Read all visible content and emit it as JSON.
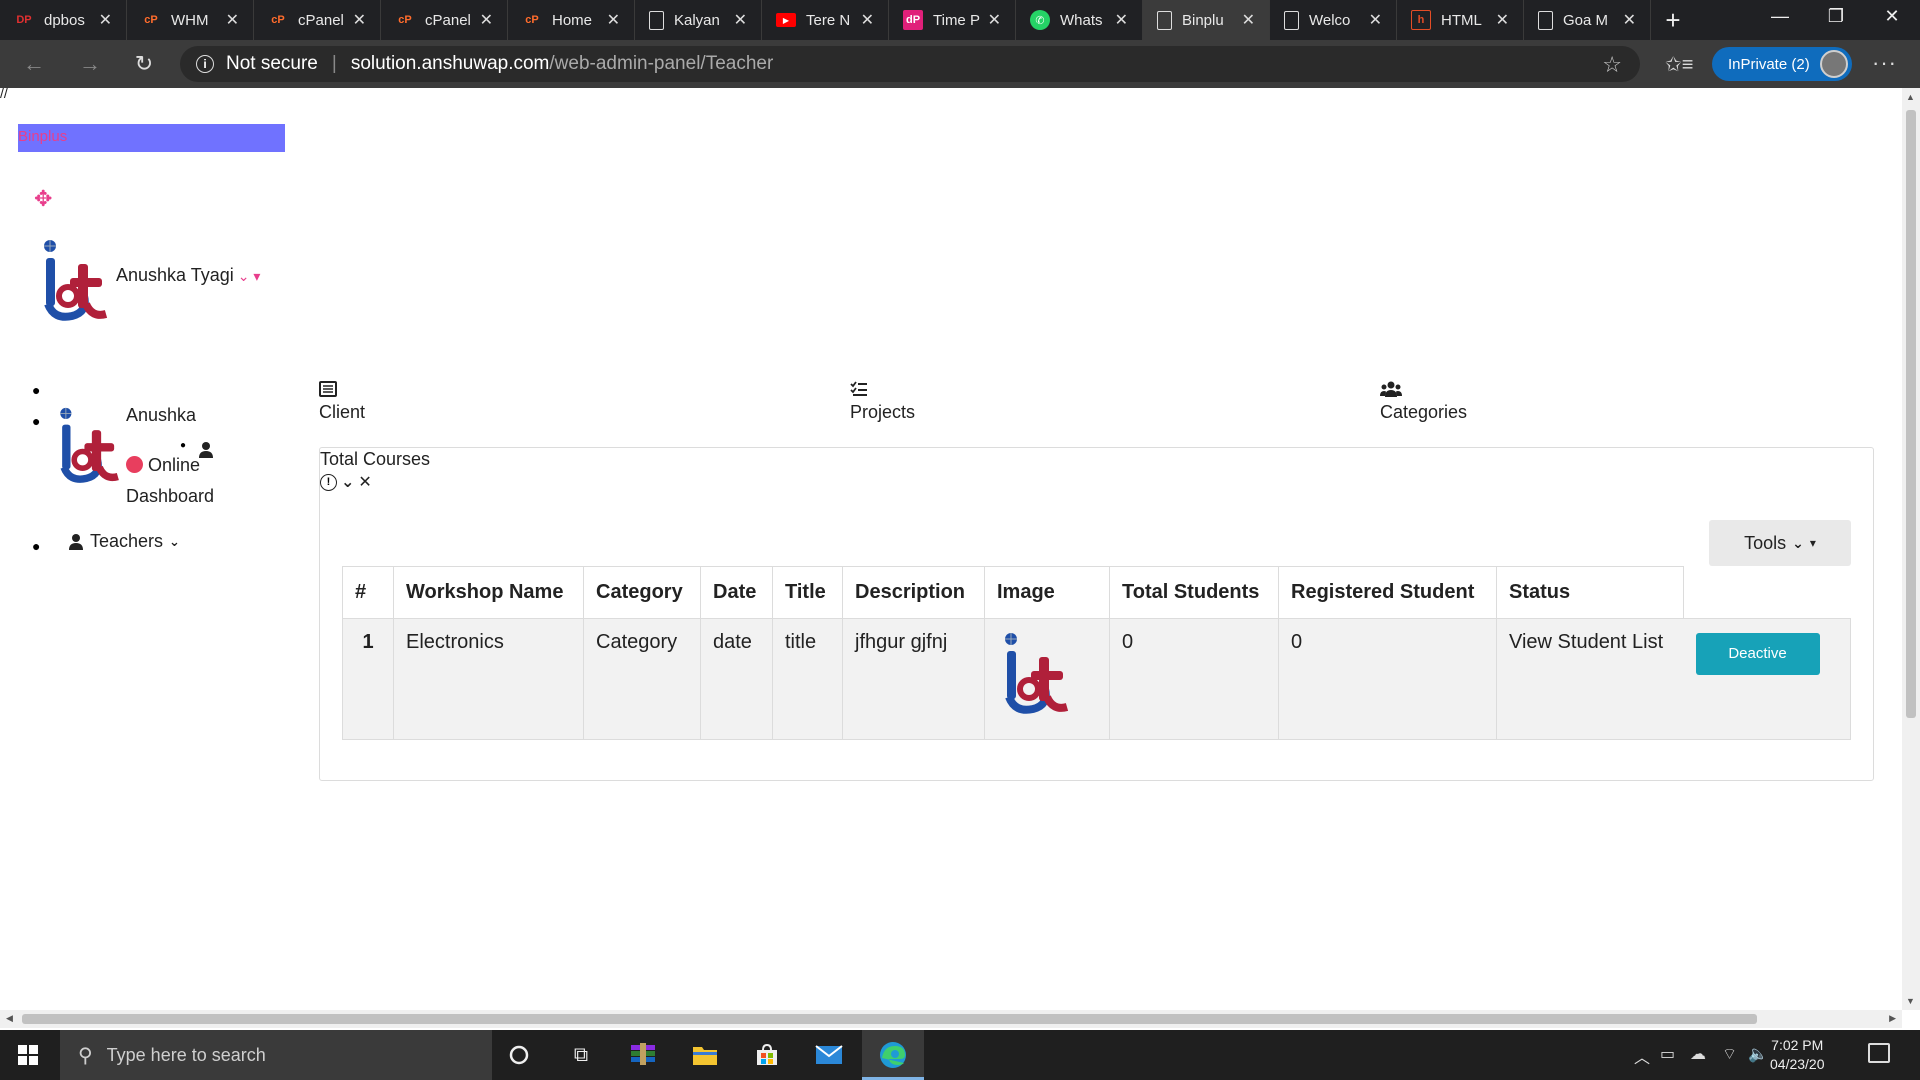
{
  "browser": {
    "tabs": [
      {
        "title": "dpbos",
        "favicon": "DP",
        "color": "#e03030",
        "active": false
      },
      {
        "title": "WHM",
        "favicon": "cP",
        "color": "#ff6c2c",
        "active": false
      },
      {
        "title": "cPanel",
        "favicon": "cP",
        "color": "#ff6c2c",
        "active": false
      },
      {
        "title": "cPanel",
        "favicon": "cP",
        "color": "#ff6c2c",
        "active": false
      },
      {
        "title": "Home",
        "favicon": "cP",
        "color": "#ff6c2c",
        "active": false
      },
      {
        "title": "Kalyan",
        "favicon": "page",
        "color": "#dddddd",
        "active": false
      },
      {
        "title": "Tere N",
        "favicon": "yt",
        "color": "#ff0000",
        "active": false
      },
      {
        "title": "Time P",
        "favicon": "dP",
        "color": "#e0207a",
        "active": false
      },
      {
        "title": "Whats",
        "favicon": "wa",
        "color": "#25d366",
        "active": false
      },
      {
        "title": "Binplu",
        "favicon": "page",
        "color": "#dddddd",
        "active": true
      },
      {
        "title": "Welco",
        "favicon": "page",
        "color": "#dddddd",
        "active": false
      },
      {
        "title": "HTML",
        "favicon": "h",
        "color": "#e44d26",
        "active": false
      },
      {
        "title": "Goa M",
        "favicon": "page",
        "color": "#dddddd",
        "active": false
      }
    ],
    "security_label": "Not secure",
    "url_host": "solution.anshuwap.com",
    "url_path": "/web-admin-panel/Teacher",
    "inprivate_label": "InPrivate (2)"
  },
  "page": {
    "stray_text": "//",
    "brand": "Binplus",
    "user_name": "Anushka Tyagi",
    "sidebar": {
      "name": "Anushka",
      "status": "Online",
      "dashboard": "Dashboard",
      "teachers": "Teachers"
    },
    "topnav": [
      {
        "label": "Client",
        "icon": "list-icon"
      },
      {
        "label": "Projects",
        "icon": "tasks-icon"
      },
      {
        "label": "Categories",
        "icon": "users-icon"
      }
    ],
    "card": {
      "title": "Total Courses",
      "tools_label": "Tools"
    },
    "table": {
      "headers": [
        "#",
        "Workshop Name",
        "Category",
        "Date",
        "Title",
        "Description",
        "Image",
        "Total Students",
        "Registered Student",
        "Status"
      ],
      "rows": [
        {
          "num": "1",
          "workshop": "Electronics",
          "category": "Category",
          "date": "date",
          "title": "title",
          "description": "jfhgur gjfnj",
          "total_students": "0",
          "registered": "0",
          "status": "View Student List",
          "action": "Deactive"
        }
      ]
    }
  },
  "taskbar": {
    "search_placeholder": "Type here to search",
    "time": "7:02 PM",
    "date": "04/23/20"
  },
  "colors": {
    "accent_pink": "#e83e8c",
    "brand_bar": "#7072ff",
    "button_teal": "#17a2b8",
    "logo_blue": "#1f4fa8",
    "logo_red": "#b0203a"
  }
}
